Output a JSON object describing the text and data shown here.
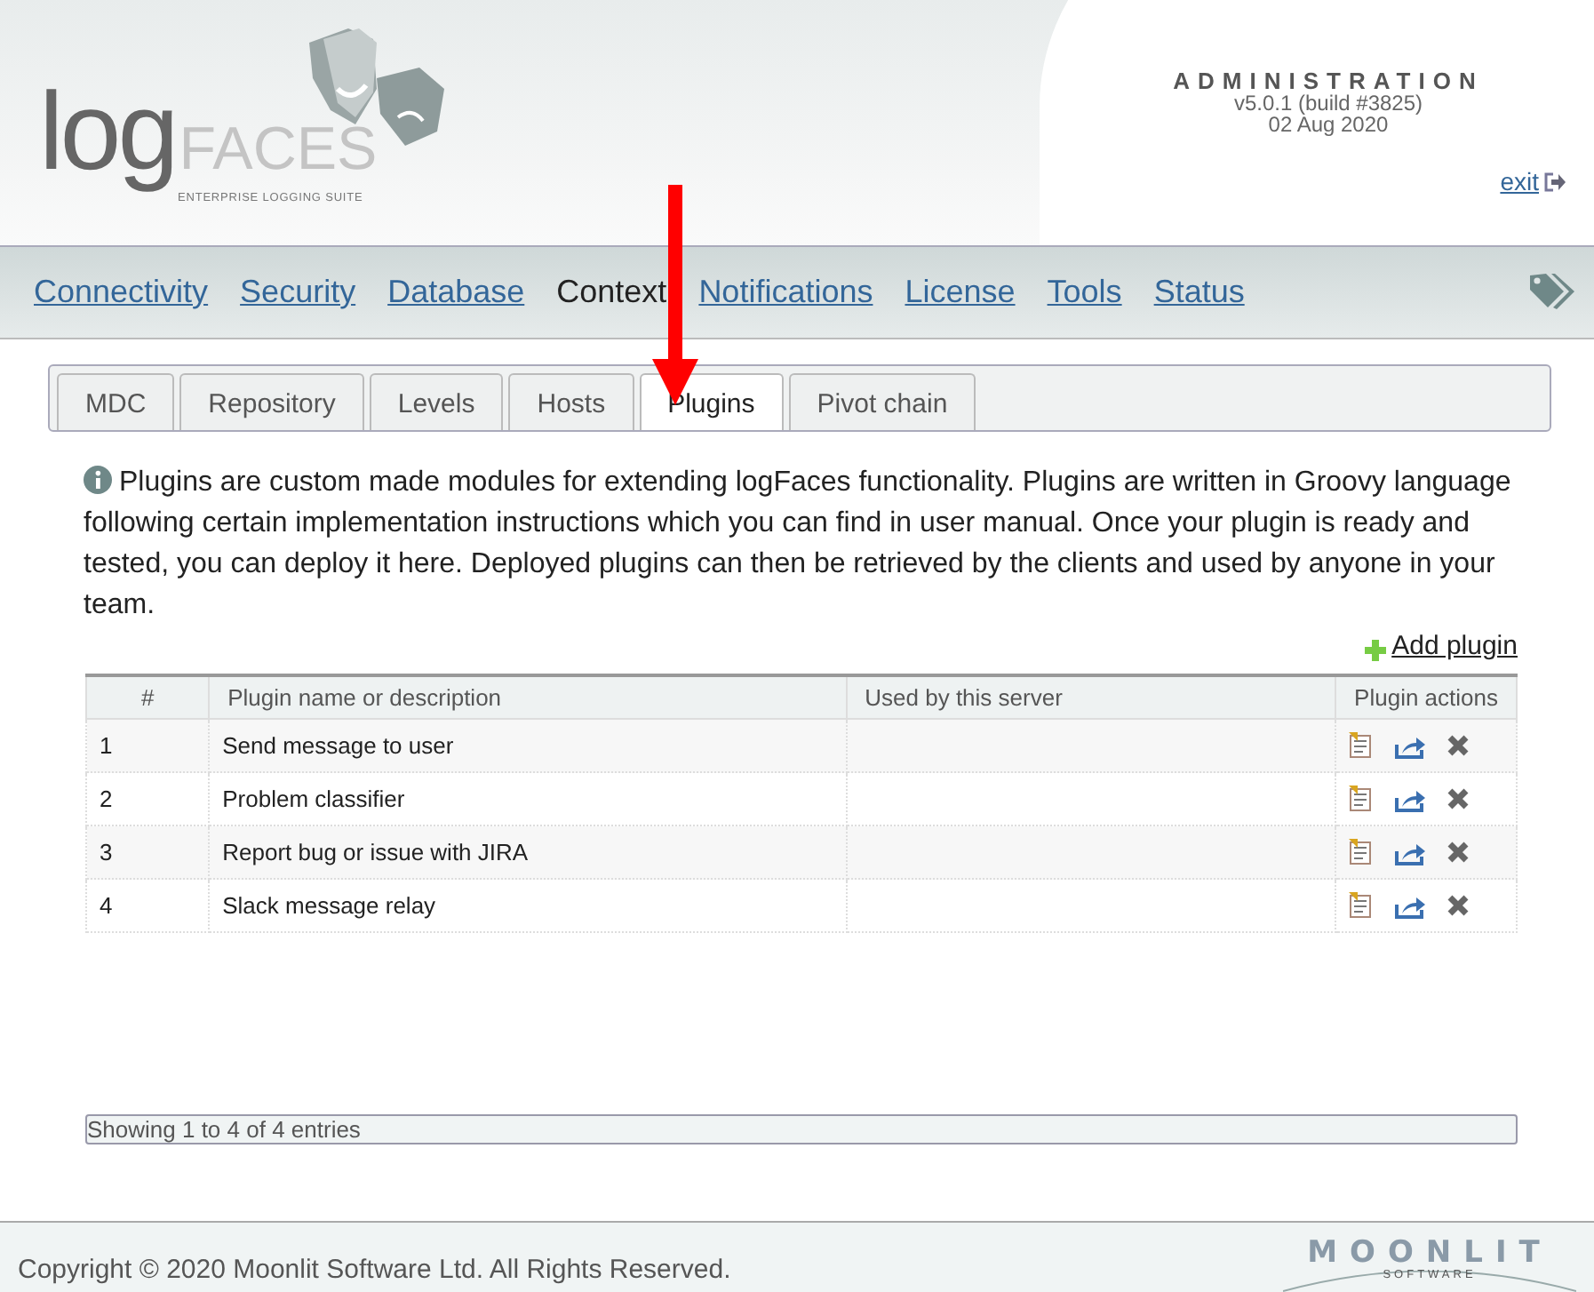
{
  "header": {
    "logo": {
      "log": "log",
      "faces": "FACES",
      "tagline": "ENTERPRISE LOGGING SUITE"
    },
    "title": "ADMINISTRATION",
    "version": "v5.0.1 (build #3825)",
    "date": "02 Aug 2020",
    "exit": "exit"
  },
  "nav": [
    {
      "label": "Connectivity",
      "selected": false
    },
    {
      "label": "Security",
      "selected": false
    },
    {
      "label": "Database",
      "selected": false
    },
    {
      "label": "Context",
      "selected": true
    },
    {
      "label": "Notifications",
      "selected": false
    },
    {
      "label": "License",
      "selected": false
    },
    {
      "label": "Tools",
      "selected": false
    },
    {
      "label": "Status",
      "selected": false
    }
  ],
  "tabs": [
    {
      "label": "MDC",
      "selected": false
    },
    {
      "label": "Repository",
      "selected": false
    },
    {
      "label": "Levels",
      "selected": false
    },
    {
      "label": "Hosts",
      "selected": false
    },
    {
      "label": "Plugins",
      "selected": true
    },
    {
      "label": "Pivot chain",
      "selected": false
    }
  ],
  "description": "Plugins are custom made modules for extending logFaces functionality. Plugins are written in Groovy language following certain implementation instructions which you can find in user manual. Once your plugin is ready and tested, you can deploy it here. Deployed plugins can then be retrieved by the clients and used by anyone in your team.",
  "add_plugin": "Add plugin",
  "table": {
    "columns": [
      "#",
      "Plugin name or description",
      "Used by this server",
      "Plugin actions"
    ],
    "rows": [
      {
        "number": "1",
        "name": "Send message to user",
        "used_by": ""
      },
      {
        "number": "2",
        "name": "Problem classifier",
        "used_by": ""
      },
      {
        "number": "3",
        "name": "Report bug or issue with JIRA",
        "used_by": ""
      },
      {
        "number": "4",
        "name": "Slack message relay",
        "used_by": ""
      }
    ],
    "info": "Showing 1 to 4 of 4 entries"
  },
  "footer": {
    "copyright": "Copyright © 2020 Moonlit Software Ltd. All Rights Reserved.",
    "logo": {
      "name": "MOONLIT",
      "sub": "SOFTWARE"
    }
  }
}
